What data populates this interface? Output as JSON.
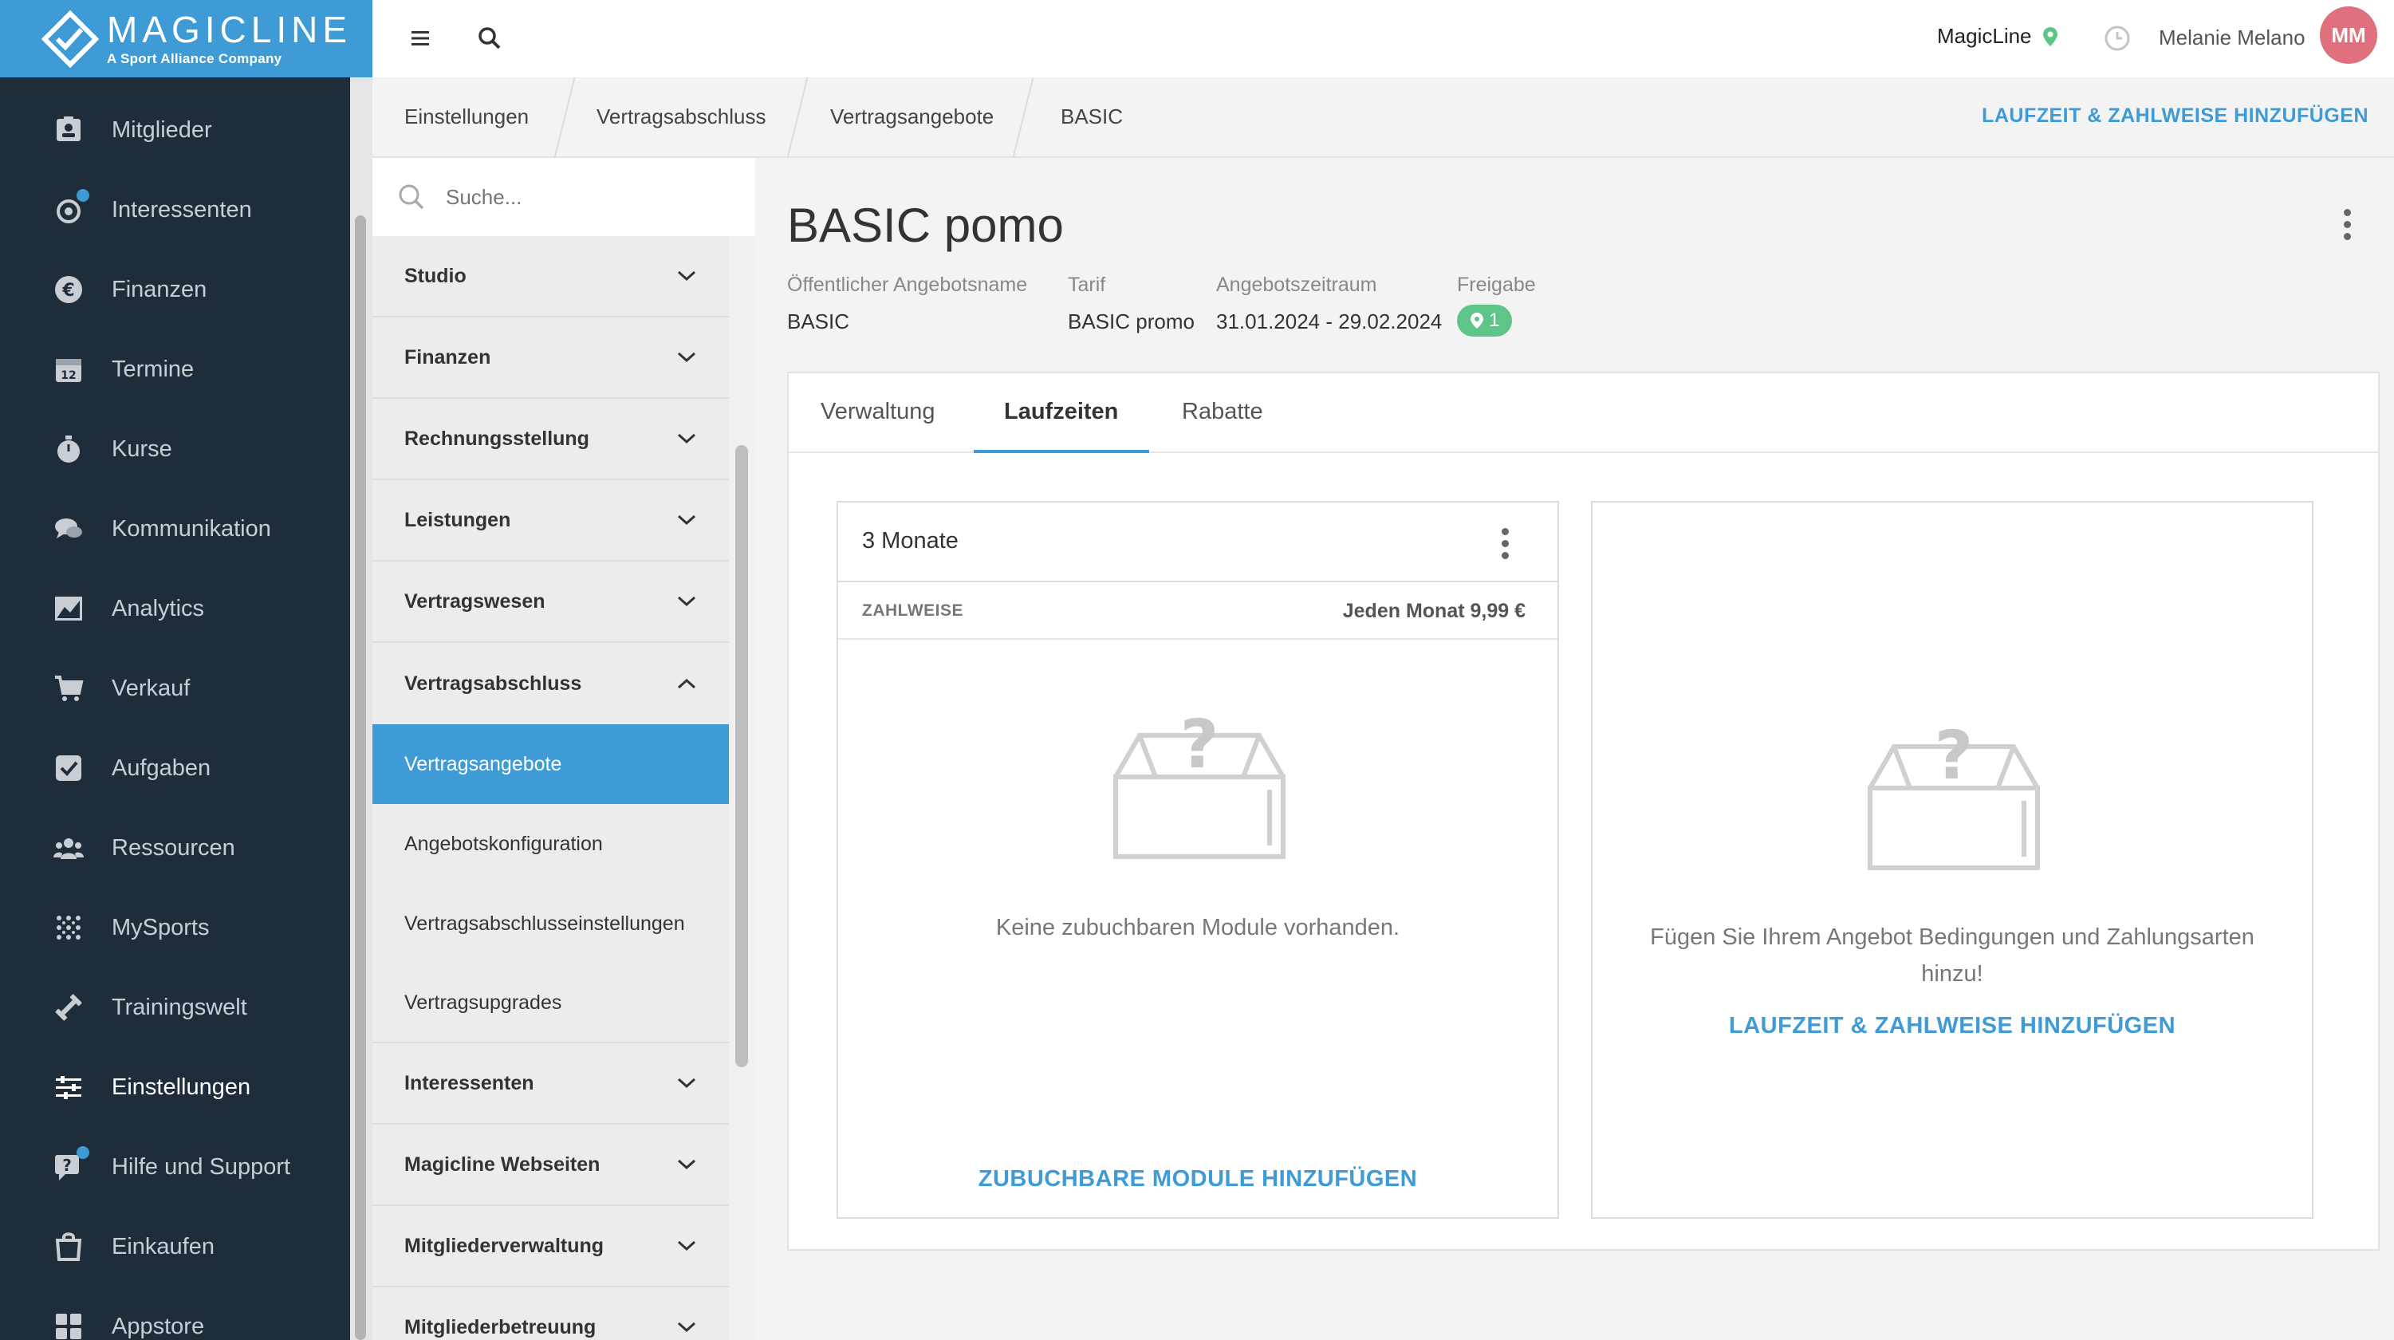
{
  "brand": {
    "name": "MAGICLINE",
    "subtitle": "A Sport Alliance Company"
  },
  "nav": {
    "items": [
      {
        "label": "Mitglieder",
        "icon": "member-card-icon"
      },
      {
        "label": "Interessenten",
        "icon": "prospects-icon"
      },
      {
        "label": "Finanzen",
        "icon": "euro-icon"
      },
      {
        "label": "Termine",
        "icon": "calendar-icon"
      },
      {
        "label": "Kurse",
        "icon": "stopwatch-icon"
      },
      {
        "label": "Kommunikation",
        "icon": "chat-icon"
      },
      {
        "label": "Analytics",
        "icon": "chart-icon"
      },
      {
        "label": "Verkauf",
        "icon": "cart-icon"
      },
      {
        "label": "Aufgaben",
        "icon": "checkbox-icon"
      },
      {
        "label": "Ressourcen",
        "icon": "people-icon"
      },
      {
        "label": "MySports",
        "icon": "dots-grid-icon"
      },
      {
        "label": "Trainingswelt",
        "icon": "dumbbell-icon"
      },
      {
        "label": "Einstellungen",
        "icon": "sliders-icon"
      },
      {
        "label": "Hilfe und Support",
        "icon": "help-icon"
      },
      {
        "label": "Einkaufen",
        "icon": "shop-icon"
      },
      {
        "label": "Appstore",
        "icon": "apps-icon"
      }
    ],
    "active": "Einstellungen"
  },
  "topbar": {
    "studio": "MagicLine",
    "user": "Melanie Melano",
    "initials": "MM"
  },
  "breadcrumb": {
    "items": [
      "Einstellungen",
      "Vertragsabschluss",
      "Vertragsangebote",
      "BASIC"
    ],
    "action": "LAUFZEIT & ZAHLWEISE HINZUFÜGEN"
  },
  "submenu": {
    "search_placeholder": "Suche...",
    "groups_top": [
      "Studio",
      "Finanzen",
      "Rechnungsstellung",
      "Leistungen",
      "Vertragswesen",
      "Vertragsabschluss"
    ],
    "subitems": [
      "Vertragsangebote",
      "Angebotskonfiguration",
      "Vertragsabschlusseinstellungen",
      "Vertragsupgrades"
    ],
    "groups_bottom": [
      "Interessenten",
      "Magicline Webseiten",
      "Mitgliederverwaltung",
      "Mitgliederbetreuung"
    ]
  },
  "offer": {
    "title": "BASIC pomo",
    "meta": [
      {
        "label": "Öffentlicher Angebotsname",
        "value": "BASIC"
      },
      {
        "label": "Tarif",
        "value": "BASIC promo"
      },
      {
        "label": "Angebotszeitraum",
        "value": "31.01.2024 - 29.02.2024"
      }
    ],
    "release_label": "Freigabe",
    "release_count": "1"
  },
  "tabs": [
    "Verwaltung",
    "Laufzeiten",
    "Rabatte"
  ],
  "active_tab": "Laufzeiten",
  "term_box": {
    "title": "3 Monate",
    "payment_label": "ZAHLWEISE",
    "payment_value": "Jeden Monat 9,99 €",
    "empty_text": "Keine zubuchbaren Module vorhanden.",
    "action": "ZUBUCHBARE MODULE HINZUFÜGEN"
  },
  "add_box": {
    "text_line1": "Fügen Sie Ihrem Angebot Bedingungen und Zahlungsarten",
    "text_line2": "hinzu!",
    "action": "LAUFZEIT & ZAHLWEISE HINZUFÜGEN"
  },
  "colors": {
    "sidebar": "#1f2d3a",
    "accent": "#3e9bd6",
    "badge": "#5cc587",
    "avatar": "#e0707e"
  }
}
